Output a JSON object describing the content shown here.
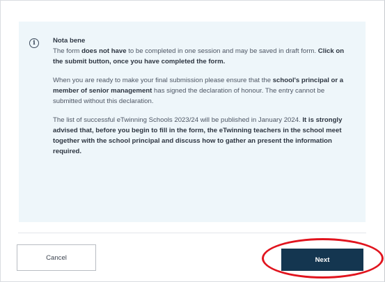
{
  "notice": {
    "title": "Nota bene",
    "para1": {
      "t1": "The form ",
      "b1": "does not have",
      "t2": " to be completed in one session and may be saved in draft form. ",
      "b2": "Click on the submit button, once you have completed the form."
    },
    "para2": {
      "t1": "When you are ready to make your final submission please ensure that the ",
      "b1": "school's principal or a member of senior management",
      "t2": " has signed the declaration of honour. The entry cannot be submitted without this declaration."
    },
    "para3": {
      "t1": "The list of successful eTwinning Schools 2023/24 will be published in January 2024. ",
      "b1": "It is strongly advised that, before you begin to fill in the form, the eTwinning teachers in the school meet together with the school principal and discuss how to gather an present the information required."
    }
  },
  "actions": {
    "cancel_label": "Cancel",
    "next_label": "Next"
  },
  "colors": {
    "notice_bg": "#eef6fa",
    "primary_button": "#143650",
    "highlight_ring": "#e1141e"
  },
  "icons": {
    "notice": "info-circle-icon"
  }
}
